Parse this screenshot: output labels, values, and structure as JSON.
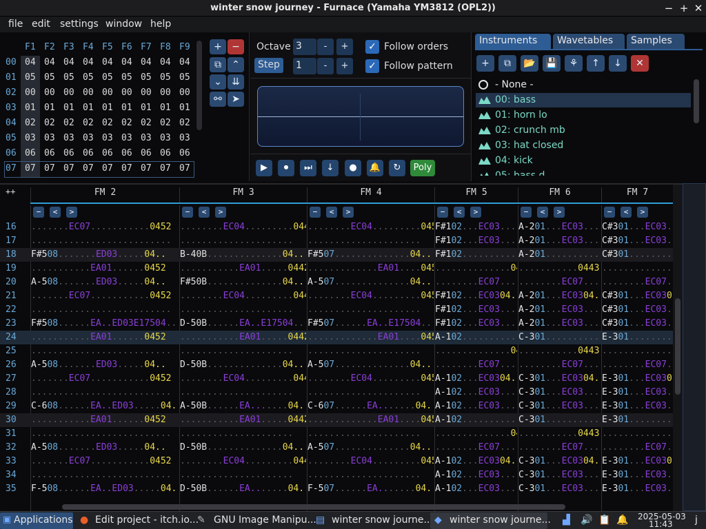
{
  "window": {
    "title": "winter snow journey - Furnace (Yamaha YM3812 (OPL2))",
    "minimize": "−",
    "maximize": "+",
    "close": "✕"
  },
  "menu": [
    "file",
    "edit",
    "settings",
    "window",
    "help"
  ],
  "orders": {
    "headers": [
      "F1",
      "F2",
      "F3",
      "F4",
      "F5",
      "F6",
      "F7",
      "F8",
      "F9"
    ],
    "rows": [
      {
        "n": "00",
        "v": [
          "04",
          "04",
          "04",
          "04",
          "04",
          "04",
          "04",
          "04",
          "04"
        ]
      },
      {
        "n": "01",
        "v": [
          "05",
          "05",
          "05",
          "05",
          "05",
          "05",
          "05",
          "05",
          "05"
        ]
      },
      {
        "n": "02",
        "v": [
          "00",
          "00",
          "00",
          "00",
          "00",
          "00",
          "00",
          "00",
          "00"
        ]
      },
      {
        "n": "03",
        "v": [
          "01",
          "01",
          "01",
          "01",
          "01",
          "01",
          "01",
          "01",
          "01"
        ]
      },
      {
        "n": "04",
        "v": [
          "02",
          "02",
          "02",
          "02",
          "02",
          "02",
          "02",
          "02",
          "02"
        ]
      },
      {
        "n": "05",
        "v": [
          "03",
          "03",
          "03",
          "03",
          "03",
          "03",
          "03",
          "03",
          "03"
        ]
      },
      {
        "n": "06",
        "v": [
          "06",
          "06",
          "06",
          "06",
          "06",
          "06",
          "06",
          "06",
          "06"
        ]
      },
      {
        "n": "07",
        "v": [
          "07",
          "07",
          "07",
          "07",
          "07",
          "07",
          "07",
          "07",
          "07"
        ]
      }
    ]
  },
  "controls": {
    "octave_label": "Octave",
    "octave_value": "3",
    "step_label": "Step",
    "step_value": "1",
    "minus": "-",
    "plus": "+",
    "follow_orders": "Follow orders",
    "follow_pattern": "Follow pattern",
    "poly": "Poly"
  },
  "instruments": {
    "tabs": [
      "Instruments",
      "Wavetables",
      "Samples"
    ],
    "none_label": "- None -",
    "items": [
      "00: bass",
      "01: horn lo",
      "02: crunch mb",
      "03: hat closed",
      "04: kick",
      "05: bass d"
    ]
  },
  "pattern": {
    "add_label": "++",
    "channels": [
      "FM 2",
      "FM 3",
      "FM 4",
      "FM 5",
      "FM 6",
      "FM 7"
    ],
    "rows": [
      {
        "n": "16",
        "c": [
          ".......EC07...........0452",
          "........EC04.........0442",
          "........EC04.........0452",
          "F#102...EC03....",
          "A-201...EC03....",
          "C#301...EC03...."
        ]
      },
      {
        "n": "17",
        "c": [
          "..........................",
          ".....................",
          ".....................",
          "F#102...EC03....",
          "A-201...EC03....",
          "C#301...EC03...."
        ]
      },
      {
        "n": "18",
        "c": [
          "F#508.......ED03.....04..",
          "B-40B..............04..",
          "F#507..............04..",
          "F#102...........",
          "A-201...........",
          "C#301..........."
        ]
      },
      {
        "n": "19",
        "c": [
          "...........EA01......0452",
          "...........EA01.....0442",
          ".............EA01....0452",
          "..............0433",
          "...........0443",
          "...............04"
        ]
      },
      {
        "n": "20",
        "c": [
          "A-508.......ED03.....04..",
          "F#50B..............04..",
          "A-507..............04..",
          "........EC07....",
          "........EC07....",
          "........EC07.."
        ]
      },
      {
        "n": "21",
        "c": [
          ".......EC07...........0452",
          "........EC04.........0442",
          "........EC04.........0452",
          "F#102...EC0304..",
          "A-201...EC0304..",
          "C#301...EC0304"
        ]
      },
      {
        "n": "22",
        "c": [
          "..........................",
          ".....................",
          ".....................",
          "F#102...EC03....",
          "A-201...EC03....",
          "C#301...EC03...."
        ]
      },
      {
        "n": "23",
        "c": [
          "F#508......EA..ED03E17504..",
          "D-50B......EA..E17504..",
          "F#507......EA..E17504..",
          "F#102...EC03....",
          "A-201...EC03....",
          "C#301...EC03...."
        ]
      },
      {
        "n": "24",
        "c": [
          "...........EA01......0452",
          "...........EA01.....0442",
          ".............EA01....0452",
          "A-102...........",
          "C-301...........",
          "E-301..........."
        ]
      },
      {
        "n": "25",
        "c": [
          "..........................",
          ".....................",
          ".....................",
          "..............0433",
          "...........0443",
          "...............04"
        ]
      },
      {
        "n": "26",
        "c": [
          "A-508.......ED03.....04..",
          "D-50B..............04..",
          "A-507..............04..",
          "........EC07....",
          "........EC07....",
          "........EC07.."
        ]
      },
      {
        "n": "27",
        "c": [
          ".......EC07...........0452",
          "........EC04.........0442",
          "........EC04.........0452",
          "A-102...EC0304..",
          "C-301...EC0304..",
          "E-301...EC0304"
        ]
      },
      {
        "n": "28",
        "c": [
          "..........................",
          ".....................",
          ".....................",
          "A-102...EC03....",
          "C-301...EC03....",
          "E-301...EC03...."
        ]
      },
      {
        "n": "29",
        "c": [
          "C-608......EA..ED03.....04..",
          "A-50B......EA.......04..",
          "C-607......EA.......04..",
          "A-102...EC03....",
          "C-301...EC03....",
          "E-301...EC03...."
        ]
      },
      {
        "n": "30",
        "c": [
          "...........EA01......0452",
          "...........EA01.....0442",
          ".............EA01....0452",
          "A-102...........",
          "C-301...........",
          "E-301..........."
        ]
      },
      {
        "n": "31",
        "c": [
          "..........................",
          ".....................",
          ".....................",
          "..............0433",
          "...........0443",
          "...............04"
        ]
      },
      {
        "n": "32",
        "c": [
          "A-508.......ED03.....04..",
          "D-50B..............04..",
          "A-507..............04..",
          "........EC07....",
          "........EC07....",
          "........EC07.."
        ]
      },
      {
        "n": "33",
        "c": [
          ".......EC07...........0452",
          "........EC04.........0442",
          "........EC04.........0452",
          "A-102...EC0304..",
          "C-301...EC0304..",
          "E-301...EC0304"
        ]
      },
      {
        "n": "34",
        "c": [
          "..........................",
          ".....................",
          ".....................",
          "A-102...EC03....",
          "C-301...EC03....",
          "E-301...EC03...."
        ]
      },
      {
        "n": "35",
        "c": [
          "F-508......EA..ED03.....04..",
          "D-50B......EA.......04..",
          "F-507......EA.......04..",
          "A-102...EC03....",
          "C-301...EC03....",
          "E-301...EC03...."
        ]
      }
    ]
  },
  "taskbar": {
    "apps_label": "Applications",
    "items": [
      "Edit project - itch.io...",
      "GNU Image Manipu...",
      "winter snow journe...",
      "winter snow journe..."
    ],
    "date": "2025-05-03",
    "time": "11:43",
    "user": "j"
  },
  "colors": {
    "accent": "#2e5c94",
    "note": "#e6e6e6",
    "instrument": "#6aa9d8",
    "effect": "#8a3fd8",
    "volume": "#e8d84a",
    "inst_list": "#7cd9c6",
    "row_num": "#6aa9d8"
  }
}
